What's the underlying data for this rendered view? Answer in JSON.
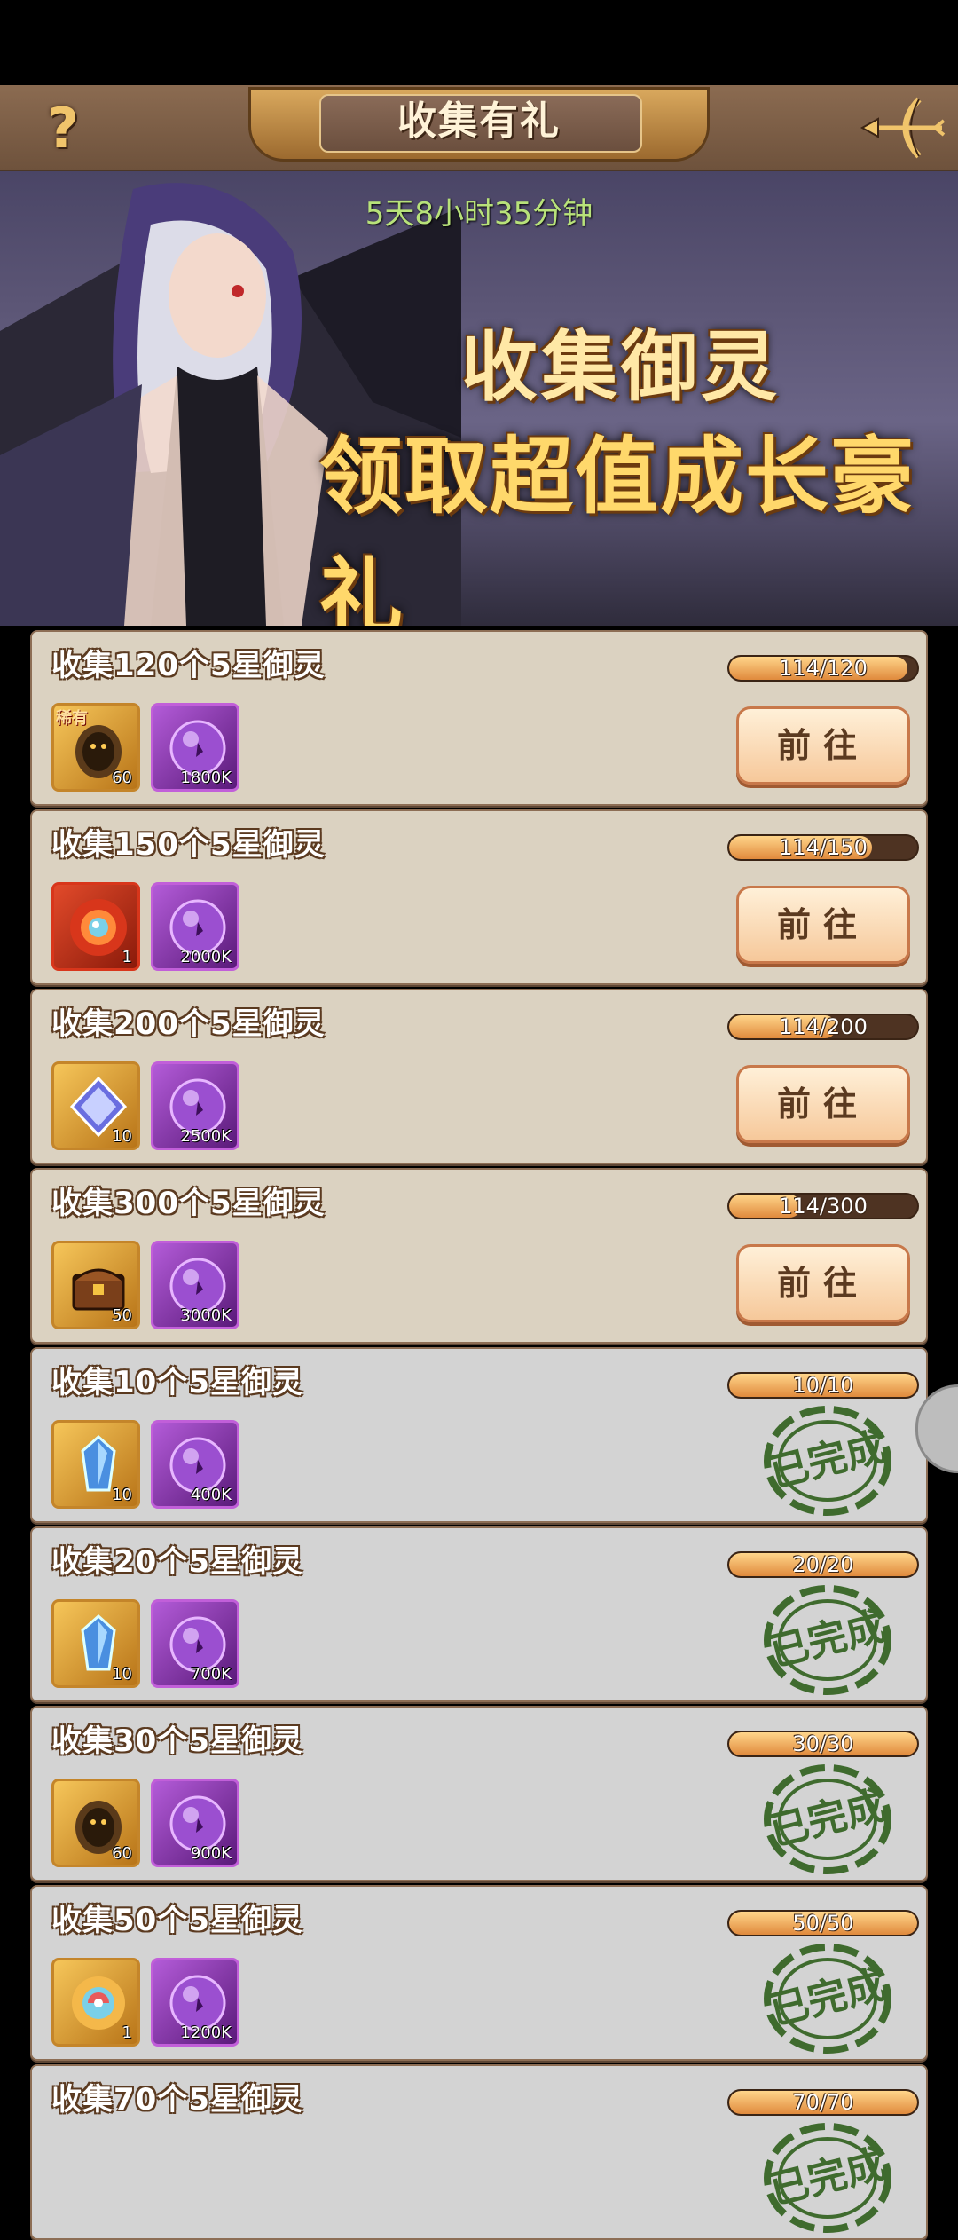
{
  "header": {
    "title": "收集有礼",
    "help_glyph": "?",
    "back_icon": "bow-arrow-back-icon"
  },
  "banner": {
    "timer": "5天8小时35分钟",
    "headline1": "收集御灵",
    "headline2": "领取超值成长豪礼"
  },
  "tasks": [
    {
      "title": "收集120个5星御灵",
      "progress": "114/120",
      "fraction": 0.95,
      "state": "go",
      "button": "前往",
      "items": [
        {
          "icon": "dark-spirit-egg-icon",
          "tag": "稀有",
          "qty": "60",
          "style": "gold"
        },
        {
          "icon": "purple-orb-icon",
          "qty": "1800K",
          "style": "purple"
        }
      ]
    },
    {
      "title": "收集150个5星御灵",
      "progress": "114/150",
      "fraction": 0.76,
      "state": "go",
      "button": "前往",
      "items": [
        {
          "icon": "red-rainbow-orb-icon",
          "qty": "1",
          "style": "red"
        },
        {
          "icon": "purple-orb-icon",
          "qty": "2000K",
          "style": "purple"
        }
      ]
    },
    {
      "title": "收集200个5星御灵",
      "progress": "114/200",
      "fraction": 0.57,
      "state": "go",
      "button": "前往",
      "items": [
        {
          "icon": "blue-crystal-icon",
          "qty": "10",
          "style": "gold"
        },
        {
          "icon": "purple-orb-icon",
          "qty": "2500K",
          "style": "purple"
        }
      ]
    },
    {
      "title": "收集300个5星御灵",
      "progress": "114/300",
      "fraction": 0.38,
      "state": "go",
      "button": "前往",
      "items": [
        {
          "icon": "treasure-chest-icon",
          "qty": "50",
          "style": "gold"
        },
        {
          "icon": "purple-orb-icon",
          "qty": "3000K",
          "style": "purple"
        }
      ]
    },
    {
      "title": "收集10个5星御灵",
      "progress": "10/10",
      "fraction": 1,
      "state": "done",
      "stamp": "已完成",
      "items": [
        {
          "icon": "blue-gem-icon",
          "qty": "10",
          "style": "gold"
        },
        {
          "icon": "purple-orb-icon",
          "qty": "400K",
          "style": "purple"
        }
      ]
    },
    {
      "title": "收集20个5星御灵",
      "progress": "20/20",
      "fraction": 1,
      "state": "done",
      "stamp": "已完成",
      "items": [
        {
          "icon": "blue-gem-icon",
          "qty": "10",
          "style": "gold"
        },
        {
          "icon": "purple-orb-icon",
          "qty": "700K",
          "style": "purple"
        }
      ]
    },
    {
      "title": "收集30个5星御灵",
      "progress": "30/30",
      "fraction": 1,
      "state": "done",
      "stamp": "已完成",
      "items": [
        {
          "icon": "dark-spirit-egg-icon",
          "qty": "60",
          "style": "gold"
        },
        {
          "icon": "purple-orb-icon",
          "qty": "900K",
          "style": "purple"
        }
      ]
    },
    {
      "title": "收集50个5星御灵",
      "progress": "50/50",
      "fraction": 1,
      "state": "done",
      "stamp": "已完成",
      "items": [
        {
          "icon": "rainbow-orb-icon",
          "qty": "1",
          "style": "gold"
        },
        {
          "icon": "purple-orb-icon",
          "qty": "1200K",
          "style": "purple"
        }
      ]
    },
    {
      "title": "收集70个5星御灵",
      "progress": "70/70",
      "fraction": 1,
      "state": "done",
      "stamp": "已完成",
      "items": []
    }
  ],
  "colors": {
    "accent": "#e08a3c",
    "stamp": "#3f6b2e",
    "card_pending": "#dbd2c1",
    "card_done": "#d3d3d3"
  }
}
